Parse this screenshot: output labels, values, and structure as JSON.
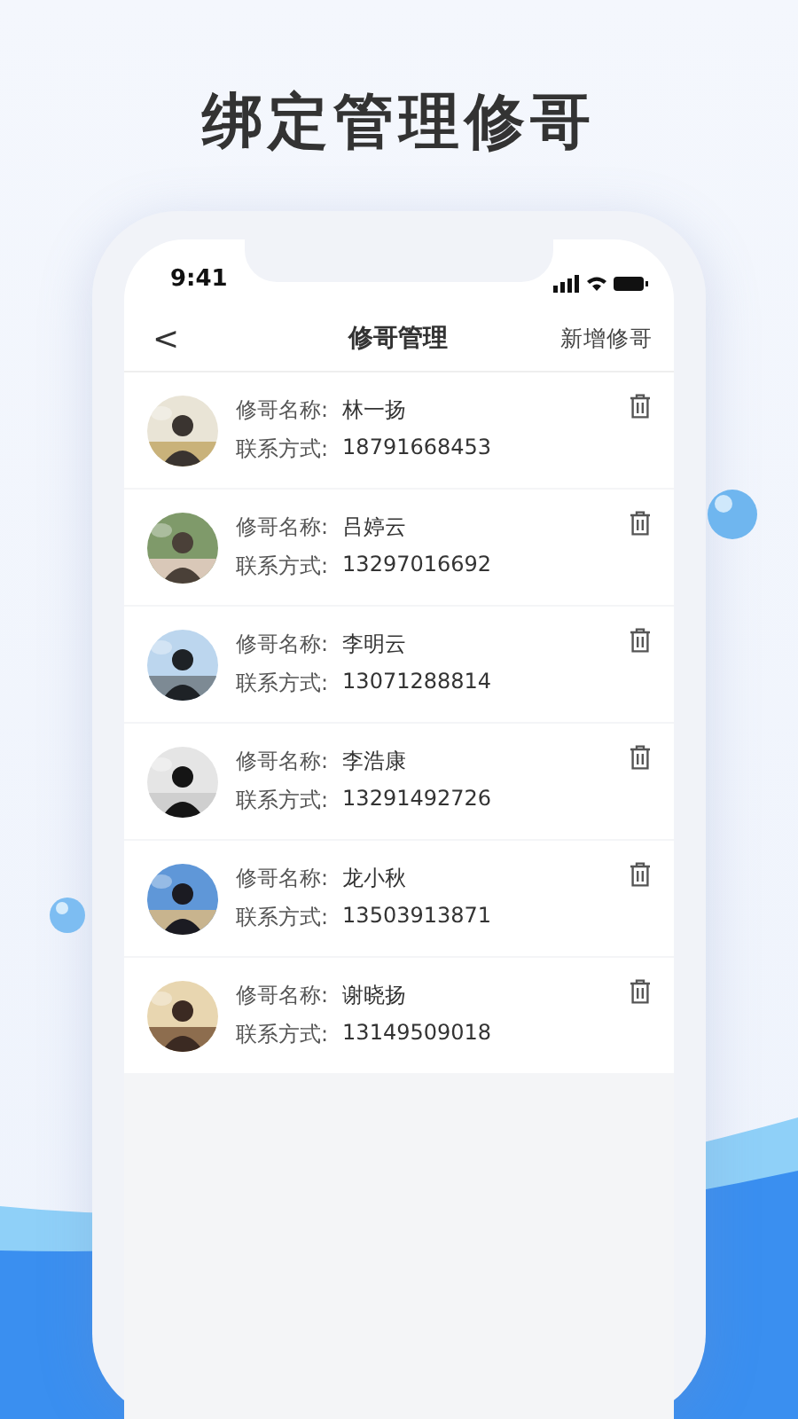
{
  "headline": "绑定管理修哥",
  "status_bar": {
    "time": "9:41"
  },
  "nav": {
    "back": "<",
    "title": "修哥管理",
    "action": "新增修哥"
  },
  "rows": [
    {
      "name_label": "修哥名称:",
      "name": "林一扬",
      "phone_label": "联系方式:",
      "phone": "18791668453"
    },
    {
      "name_label": "修哥名称:",
      "name": "吕婷云",
      "phone_label": "联系方式:",
      "phone": "13297016692"
    },
    {
      "name_label": "修哥名称:",
      "name": "李明云",
      "phone_label": "联系方式:",
      "phone": "13071288814"
    },
    {
      "name_label": "修哥名称:",
      "name": "李浩康",
      "phone_label": "联系方式:",
      "phone": "13291492726"
    },
    {
      "name_label": "修哥名称:",
      "name": "龙小秋",
      "phone_label": "联系方式:",
      "phone": "13503913871"
    },
    {
      "name_label": "修哥名称:",
      "name": "谢晓扬",
      "phone_label": "联系方式:",
      "phone": "13149509018"
    }
  ]
}
